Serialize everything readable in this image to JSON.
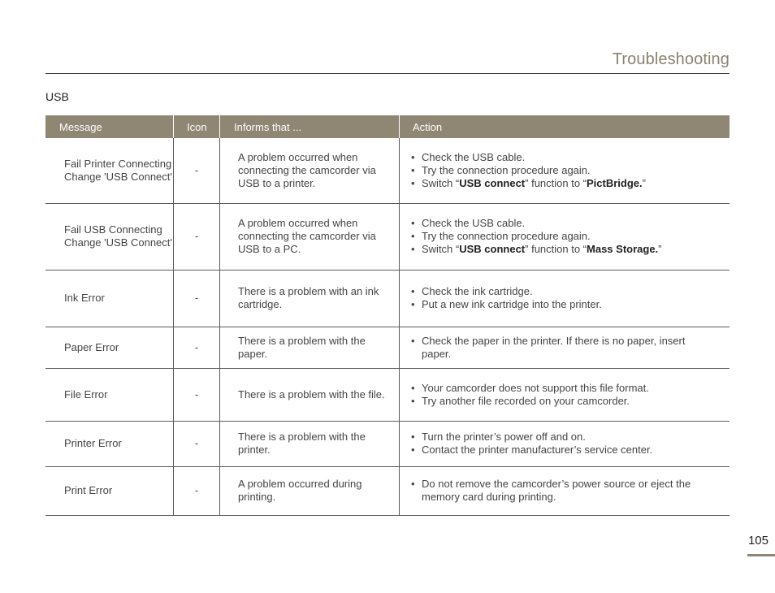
{
  "header": {
    "title": "Troubleshooting"
  },
  "section": {
    "heading": "USB"
  },
  "table": {
    "columns": [
      "Message",
      "Icon",
      "Informs that ...",
      "Action"
    ],
    "rows": [
      {
        "message": "Fail Printer Connecting Change 'USB Connect'",
        "icon": "-",
        "informs": "A problem occurred when connecting the camcorder via USB to a printer.",
        "actions": [
          {
            "text": "Check the USB cable."
          },
          {
            "text": "Try the connection procedure again."
          },
          {
            "pre": "Switch “",
            "bold1": "USB connect",
            "mid": "” function to “",
            "bold2": "PictBridge.",
            "post": "”"
          }
        ],
        "height": 80
      },
      {
        "message": "Fail USB Connecting Change 'USB Connect'",
        "icon": "-",
        "informs": "A problem occurred when connecting the camcorder via USB to a PC.",
        "actions": [
          {
            "text": "Check the USB cable."
          },
          {
            "text": "Try the connection procedure again."
          },
          {
            "pre": "Switch “",
            "bold1": "USB connect",
            "mid": "” function to “",
            "bold2": "Mass Storage.",
            "post": "”"
          }
        ],
        "height": 82
      },
      {
        "message": "Ink Error",
        "icon": "-",
        "informs": "There is a problem with an ink cartridge.",
        "actions": [
          {
            "text": "Check the ink cartridge."
          },
          {
            "text": "Put a new ink cartridge into the printer."
          }
        ],
        "height": 70
      },
      {
        "message": "Paper Error",
        "icon": "-",
        "informs": "There is a problem with the paper.",
        "actions": [
          {
            "text": "Check the paper in the printer. If there is no paper, insert paper."
          }
        ],
        "height": 51
      },
      {
        "message": "File Error",
        "icon": "-",
        "informs": "There is a problem with the file.",
        "actions": [
          {
            "text": "Your camcorder does not support this file format."
          },
          {
            "text": "Try another file recorded on your camcorder."
          }
        ],
        "height": 65
      },
      {
        "message": "Printer Error",
        "icon": "-",
        "informs": "There is a problem with the printer.",
        "actions": [
          {
            "text": "Turn the printer’s power off and on."
          },
          {
            "text": "Contact the printer manufacturer’s service center."
          }
        ],
        "height": 56
      },
      {
        "message": "Print Error",
        "icon": "-",
        "informs": "A problem occurred during printing.",
        "actions": [
          {
            "text": "Do not remove the camcorder’s power source or eject the memory card during printing."
          }
        ],
        "height": 60
      }
    ]
  },
  "footer": {
    "page_number": "105"
  }
}
